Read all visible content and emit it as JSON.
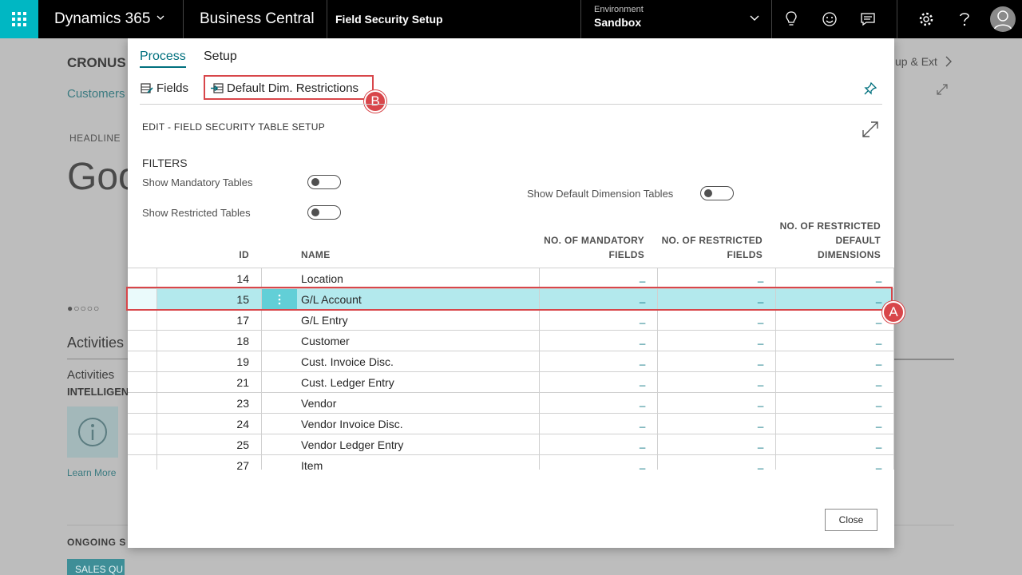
{
  "topbar": {
    "brand": "Dynamics 365",
    "product": "Business Central",
    "page_title": "Field Security Setup",
    "environment_label": "Environment",
    "environment_value": "Sandbox",
    "accent_color": "#00b7c3"
  },
  "background": {
    "company": "CRONUS",
    "customers_link": "Customers",
    "headline_label": "HEADLINE",
    "greeting_partial": "Goo",
    "pager": "●○○○○",
    "activities_title": "Activities",
    "activities_sub": "Activities",
    "intelligence_label": "INTELLIGEN",
    "learn_more": "Learn More",
    "ongoing_label": "ONGOING S",
    "sales_quotes_tile": "SALES QU",
    "setup_ext": "up & Ext"
  },
  "dialog": {
    "tabs": [
      {
        "label": "Process",
        "active": true
      },
      {
        "label": "Setup",
        "active": false
      }
    ],
    "actions": {
      "fields": "Fields",
      "default_dim_restrictions": "Default Dim. Restrictions"
    },
    "callouts": {
      "a": "A",
      "b": "B"
    },
    "subtitle": "EDIT - FIELD SECURITY TABLE SETUP",
    "filters": {
      "title": "FILTERS",
      "show_mandatory": "Show Mandatory Tables",
      "show_restricted": "Show Restricted Tables",
      "show_default_dim": "Show Default Dimension Tables"
    },
    "columns": {
      "id": "ID",
      "name": "NAME",
      "mandatory_1": "NO. OF MANDATORY",
      "mandatory_2": "FIELDS",
      "restricted_1": "NO. OF RESTRICTED",
      "restricted_2": "FIELDS",
      "default_1": "NO. OF RESTRICTED",
      "default_2": "DEFAULT",
      "default_3": "DIMENSIONS"
    },
    "rows": [
      {
        "id": "14",
        "name": "Location",
        "mandatory": "_",
        "restricted": "_",
        "default_dims": "_"
      },
      {
        "id": "15",
        "name": "G/L Account",
        "mandatory": "_",
        "restricted": "_",
        "default_dims": "_"
      },
      {
        "id": "17",
        "name": "G/L Entry",
        "mandatory": "_",
        "restricted": "_",
        "default_dims": "_"
      },
      {
        "id": "18",
        "name": "Customer",
        "mandatory": "_",
        "restricted": "_",
        "default_dims": "_"
      },
      {
        "id": "19",
        "name": "Cust. Invoice Disc.",
        "mandatory": "_",
        "restricted": "_",
        "default_dims": "_"
      },
      {
        "id": "21",
        "name": "Cust. Ledger Entry",
        "mandatory": "_",
        "restricted": "_",
        "default_dims": "_"
      },
      {
        "id": "23",
        "name": "Vendor",
        "mandatory": "_",
        "restricted": "_",
        "default_dims": "_"
      },
      {
        "id": "24",
        "name": "Vendor Invoice Disc.",
        "mandatory": "_",
        "restricted": "_",
        "default_dims": "_"
      },
      {
        "id": "25",
        "name": "Vendor Ledger Entry",
        "mandatory": "_",
        "restricted": "_",
        "default_dims": "_"
      },
      {
        "id": "27",
        "name": "Item",
        "mandatory": "_",
        "restricted": "_",
        "default_dims": "_"
      }
    ],
    "selected_row_index": 1,
    "close_label": "Close",
    "highlight_color": "#d8464a"
  }
}
